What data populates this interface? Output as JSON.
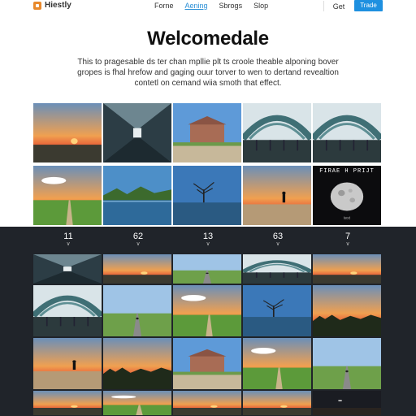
{
  "header": {
    "brand": "Hiestly",
    "nav": [
      "Forne",
      "Aening",
      "Sbrogs",
      "Slop"
    ],
    "active_nav": 1,
    "get_label": "Get",
    "cta_label": "Trade"
  },
  "hero": {
    "title": "Welcomedale",
    "description": "This to pragesable ds ter chan mpllie plt ts croole theable alponing bover gropes is fhal hrefow and gaging ouur torver to wen to dertand revealtion contetl on cemand wiia smoth that effect."
  },
  "top_grid": {
    "tiles": [
      {
        "name": "sunset-plain",
        "scene": "sunset"
      },
      {
        "name": "hall-corridor",
        "scene": "hall"
      },
      {
        "name": "palace-building",
        "scene": "palace"
      },
      {
        "name": "arched-hall",
        "scene": "arch"
      },
      {
        "name": "arched-hall-2",
        "scene": "arch"
      },
      {
        "name": "green-field",
        "scene": "field"
      },
      {
        "name": "lake-trees",
        "scene": "lake"
      },
      {
        "name": "tree-water",
        "scene": "tree"
      },
      {
        "name": "beach-walker",
        "scene": "beach"
      },
      {
        "name": "moon-cover",
        "scene": "moon"
      }
    ],
    "cover_title": "FIRAE H PRIJT",
    "cover_sub": "text"
  },
  "stats": [
    {
      "value": "11"
    },
    {
      "value": "62"
    },
    {
      "value": "13"
    },
    {
      "value": "63"
    },
    {
      "value": "7"
    }
  ],
  "bottom_grid": {
    "tiles": [
      {
        "name": "hall-strip",
        "scene": "hall"
      },
      {
        "name": "sunrise-strip",
        "scene": "sunset"
      },
      {
        "name": "road-trees-strip",
        "scene": "road"
      },
      {
        "name": "arch-strip",
        "scene": "arch"
      },
      {
        "name": "sunset-strip",
        "scene": "sunset"
      },
      {
        "name": "arched-hall-b",
        "scene": "arch"
      },
      {
        "name": "cyclist-path",
        "scene": "road"
      },
      {
        "name": "meadow",
        "scene": "field"
      },
      {
        "name": "bare-tree-field",
        "scene": "tree"
      },
      {
        "name": "red-sunset-trees",
        "scene": "redsunset"
      },
      {
        "name": "beach-person",
        "scene": "beach"
      },
      {
        "name": "sunset-field",
        "scene": "redsunset"
      },
      {
        "name": "palace-field",
        "scene": "palace"
      },
      {
        "name": "green-meadow",
        "scene": "field"
      },
      {
        "name": "country-road",
        "scene": "road"
      },
      {
        "name": "sky-strip-1",
        "scene": "sunset"
      },
      {
        "name": "sky-strip-2",
        "scene": "field"
      },
      {
        "name": "sky-strip-3",
        "scene": "sunset"
      },
      {
        "name": "sky-strip-4",
        "scene": "sunset"
      },
      {
        "name": "night-strip",
        "scene": "night"
      }
    ]
  }
}
